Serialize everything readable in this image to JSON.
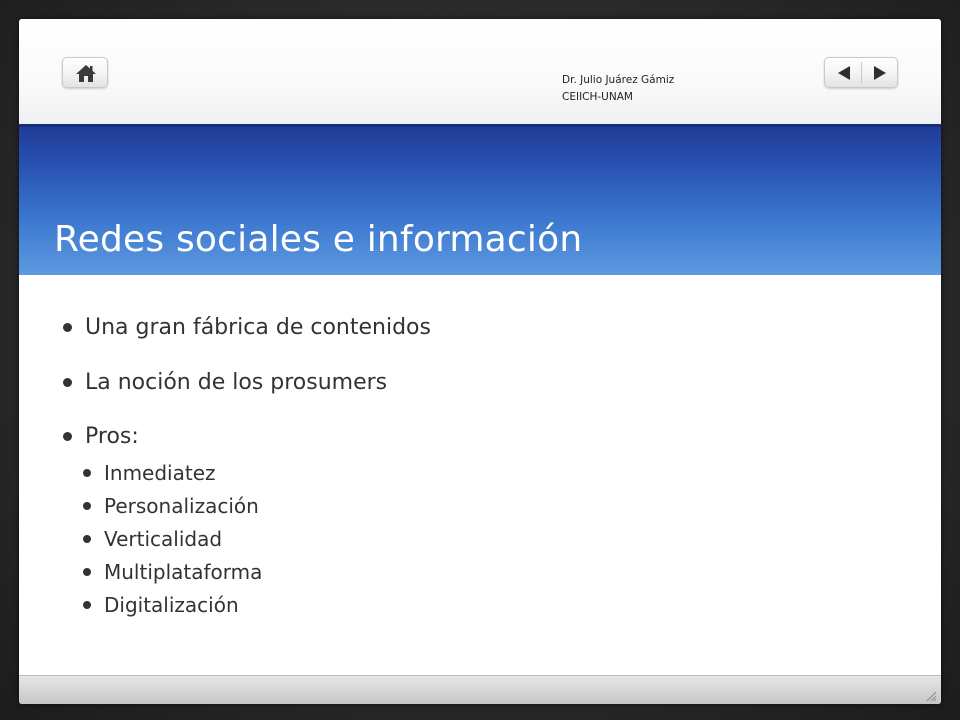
{
  "header": {
    "author_line1": "Dr. Julio Juárez Gámiz",
    "author_line2": "CEIICH-UNAM"
  },
  "icons": {
    "home": "home-icon",
    "prev": "arrow-left-icon",
    "next": "arrow-right-icon",
    "resize": "resize-grip-icon"
  },
  "slide": {
    "title": "Redes sociales e información",
    "bullets": [
      "Una gran fábrica de contenidos",
      "La noción de los prosumers",
      "Pros:"
    ],
    "sub_bullets": [
      "Inmediatez",
      "Personalización",
      "Verticalidad",
      "Multiplataforma",
      "Digitalización"
    ]
  },
  "colors": {
    "title_band_top": "#1f3a93",
    "title_band_bottom": "#5d99e0",
    "text": "#333333"
  }
}
